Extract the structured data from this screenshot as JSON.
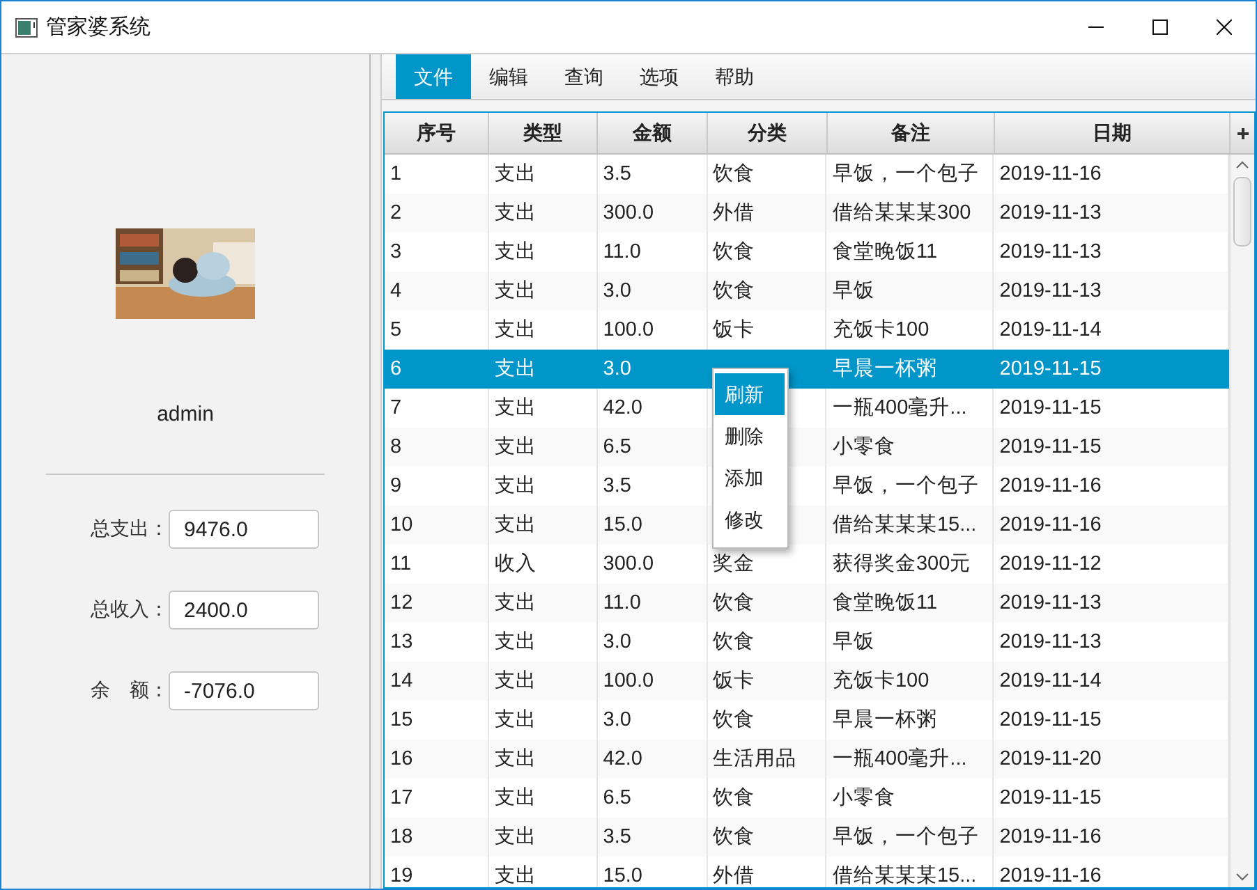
{
  "window": {
    "title": "管家婆系统"
  },
  "sidebar": {
    "username": "admin",
    "fields": [
      {
        "label": "总支出：",
        "value": "9476.0"
      },
      {
        "label": "总收入：",
        "value": "2400.0"
      },
      {
        "label": "余　额：",
        "value": "-7076.0"
      }
    ]
  },
  "menu": [
    {
      "label": "文件",
      "selected": true
    },
    {
      "label": "编辑",
      "selected": false
    },
    {
      "label": "查询",
      "selected": false
    },
    {
      "label": "选项",
      "selected": false
    },
    {
      "label": "帮助",
      "selected": false
    }
  ],
  "table": {
    "columns": [
      "序号",
      "类型",
      "金额",
      "分类",
      "备注",
      "日期"
    ],
    "rows": [
      {
        "selected": false,
        "cells": [
          "1",
          "支出",
          "3.5",
          "饮食",
          "早饭，一个包子",
          "2019-11-16"
        ]
      },
      {
        "selected": false,
        "cells": [
          "2",
          "支出",
          "300.0",
          "外借",
          "借给某某某300",
          "2019-11-13"
        ]
      },
      {
        "selected": false,
        "cells": [
          "3",
          "支出",
          "11.0",
          "饮食",
          "食堂晚饭11",
          "2019-11-13"
        ]
      },
      {
        "selected": false,
        "cells": [
          "4",
          "支出",
          "3.0",
          "饮食",
          "早饭",
          "2019-11-13"
        ]
      },
      {
        "selected": false,
        "cells": [
          "5",
          "支出",
          "100.0",
          "饭卡",
          "充饭卡100",
          "2019-11-14"
        ]
      },
      {
        "selected": true,
        "cells": [
          "6",
          "支出",
          "3.0",
          null,
          "早晨一杯粥",
          "2019-11-15"
        ]
      },
      {
        "selected": false,
        "cells": [
          "7",
          "支出",
          "42.0",
          null,
          "一瓶400毫升...",
          "2019-11-15"
        ]
      },
      {
        "selected": false,
        "cells": [
          "8",
          "支出",
          "6.5",
          null,
          "小零食",
          "2019-11-15"
        ]
      },
      {
        "selected": false,
        "cells": [
          "9",
          "支出",
          "3.5",
          null,
          "早饭，一个包子",
          "2019-11-16"
        ]
      },
      {
        "selected": false,
        "cells": [
          "10",
          "支出",
          "15.0",
          null,
          "借给某某某15...",
          "2019-11-16"
        ]
      },
      {
        "selected": false,
        "cells": [
          "11",
          "收入",
          "300.0",
          "奖金",
          "获得奖金300元",
          "2019-11-12"
        ]
      },
      {
        "selected": false,
        "cells": [
          "12",
          "支出",
          "11.0",
          "饮食",
          "食堂晚饭11",
          "2019-11-13"
        ]
      },
      {
        "selected": false,
        "cells": [
          "13",
          "支出",
          "3.0",
          "饮食",
          "早饭",
          "2019-11-13"
        ]
      },
      {
        "selected": false,
        "cells": [
          "14",
          "支出",
          "100.0",
          "饭卡",
          "充饭卡100",
          "2019-11-14"
        ]
      },
      {
        "selected": false,
        "cells": [
          "15",
          "支出",
          "3.0",
          "饮食",
          "早晨一杯粥",
          "2019-11-15"
        ]
      },
      {
        "selected": false,
        "cells": [
          "16",
          "支出",
          "42.0",
          "生活用品",
          "一瓶400毫升...",
          "2019-11-20"
        ]
      },
      {
        "selected": false,
        "cells": [
          "17",
          "支出",
          "6.5",
          "饮食",
          "小零食",
          "2019-11-15"
        ]
      },
      {
        "selected": false,
        "cells": [
          "18",
          "支出",
          "3.5",
          "饮食",
          "早饭，一个包子",
          "2019-11-16"
        ]
      },
      {
        "selected": false,
        "cells": [
          "19",
          "支出",
          "15.0",
          "外借",
          "借给某某某15...",
          "2019-11-16"
        ]
      }
    ]
  },
  "context_menu": {
    "items": [
      {
        "label": "刷新",
        "selected": true
      },
      {
        "label": "删除",
        "selected": false
      },
      {
        "label": "添加",
        "selected": false
      },
      {
        "label": "修改",
        "selected": false
      }
    ]
  }
}
